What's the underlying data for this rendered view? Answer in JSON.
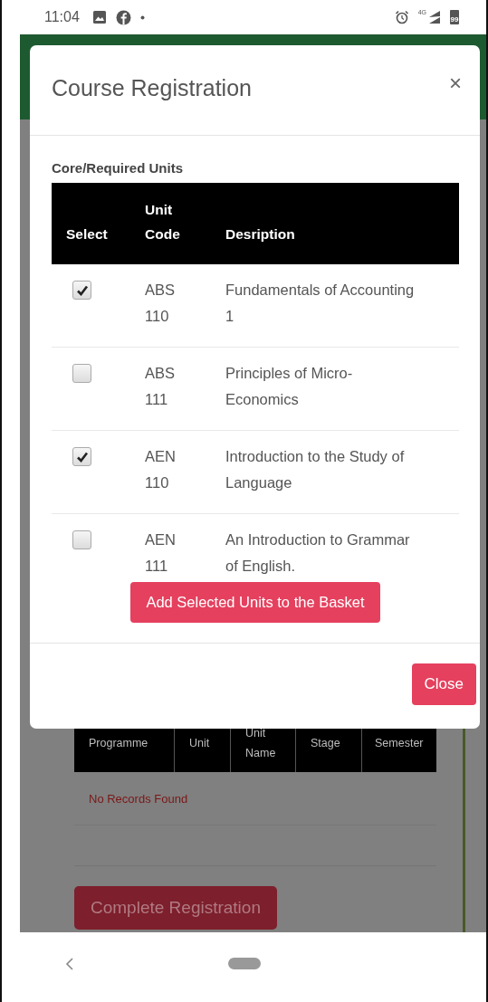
{
  "status_bar": {
    "time": "11:04",
    "network": "4G",
    "battery": "99"
  },
  "background": {
    "table": {
      "columns": [
        "Programme",
        "Unit",
        "Unit Name",
        "Stage",
        "Semester"
      ]
    },
    "empty_message": "No Records Found",
    "complete_button": "Complete Registration"
  },
  "modal": {
    "title": "Course Registration",
    "close_icon": "×",
    "section_title": "Core/Required Units",
    "table": {
      "columns": [
        "Select",
        "Unit Code",
        "Desription"
      ],
      "rows": [
        {
          "checked": true,
          "code": "ABS 110",
          "description": "Fundamentals of Accounting 1"
        },
        {
          "checked": false,
          "code": "ABS 111",
          "description": "Principles of Micro-Economics"
        },
        {
          "checked": true,
          "code": "AEN 110",
          "description": "Introduction to the Study of Language"
        },
        {
          "checked": false,
          "code": "AEN 111",
          "description": "An Introduction to Grammar of English."
        }
      ]
    },
    "add_button": "Add Selected Units to the Basket",
    "close_button": "Close"
  }
}
